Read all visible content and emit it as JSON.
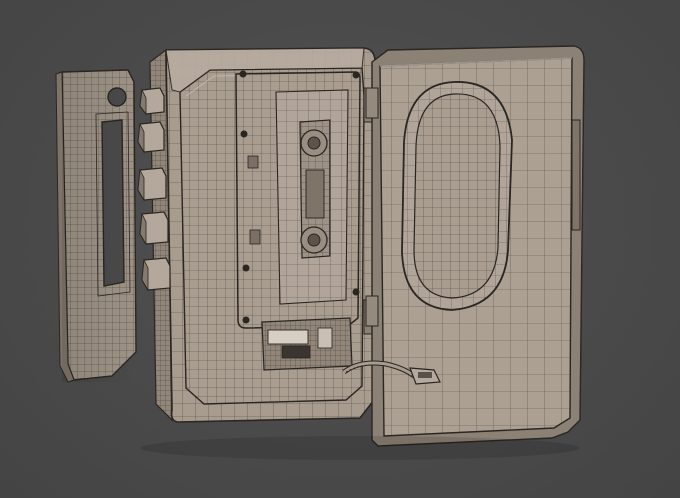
{
  "scene": {
    "subject": "cassette-player-wireframe-render",
    "colors": {
      "background": "#4a4a4a",
      "surface": "#a99d90",
      "surface_dark": "#8f8478",
      "surface_light": "#bdb2a6",
      "wire": "#2a2622",
      "shadow": "#3a3632"
    },
    "parts": {
      "side_panel": {
        "icon": "side-panel-shape"
      },
      "button_column": {
        "button_count": 5
      },
      "player_body": {
        "icon": "player-body-shape"
      },
      "cassette_tape": {
        "reel_count": 2
      },
      "open_lid": {
        "window_shape": "oval"
      },
      "cable": {
        "icon": "cable-connector-shape"
      }
    }
  }
}
